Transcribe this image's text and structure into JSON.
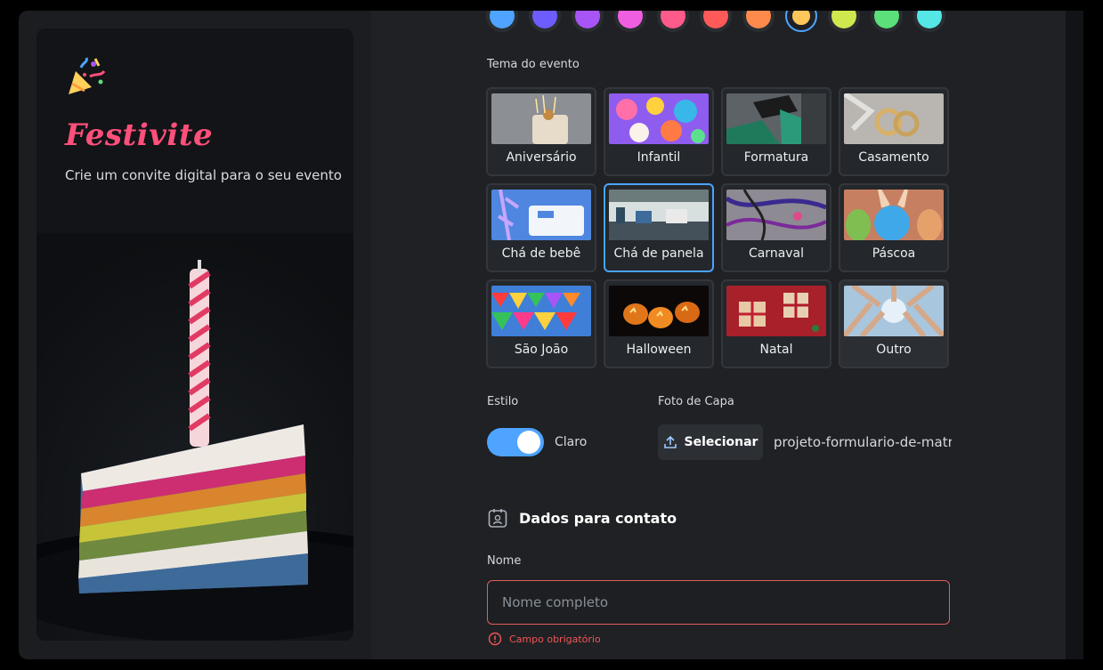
{
  "brand": {
    "title": "Festivite",
    "subtitle": "Crie um convite digital para o seu evento",
    "logo_icon": "party-popper-icon"
  },
  "colors": {
    "options": [
      "#4ea4ff",
      "#6d5cff",
      "#a855f7",
      "#f05ee0",
      "#ff5b8a",
      "#ff5a5a",
      "#ff8a4c",
      "#ffc75a",
      "#cfe84e",
      "#5be07a",
      "#56e6e6"
    ],
    "selected_index": 7,
    "accent": "#4ea4ff",
    "brand_pink": "#ff4f7b",
    "error": "#ef5656"
  },
  "theme": {
    "label": "Tema do evento",
    "items": [
      {
        "name": "Aniversário"
      },
      {
        "name": "Infantil"
      },
      {
        "name": "Formatura"
      },
      {
        "name": "Casamento"
      },
      {
        "name": "Chá de bebê"
      },
      {
        "name": "Chá de panela"
      },
      {
        "name": "Carnaval"
      },
      {
        "name": "Páscoa"
      },
      {
        "name": "São João"
      },
      {
        "name": "Halloween"
      },
      {
        "name": "Natal"
      },
      {
        "name": "Outro"
      }
    ],
    "selected": "Chá de panela"
  },
  "style": {
    "label": "Estilo",
    "toggle_value": "Claro"
  },
  "cover": {
    "label": "Foto de Capa",
    "button_label": "Selecionar",
    "file_name": "projeto-formulario-de-matri"
  },
  "contact": {
    "title": "Dados para contato",
    "name_label": "Nome",
    "name_placeholder": "Nome completo",
    "name_value": "",
    "error_text": "Campo obrigatório"
  }
}
